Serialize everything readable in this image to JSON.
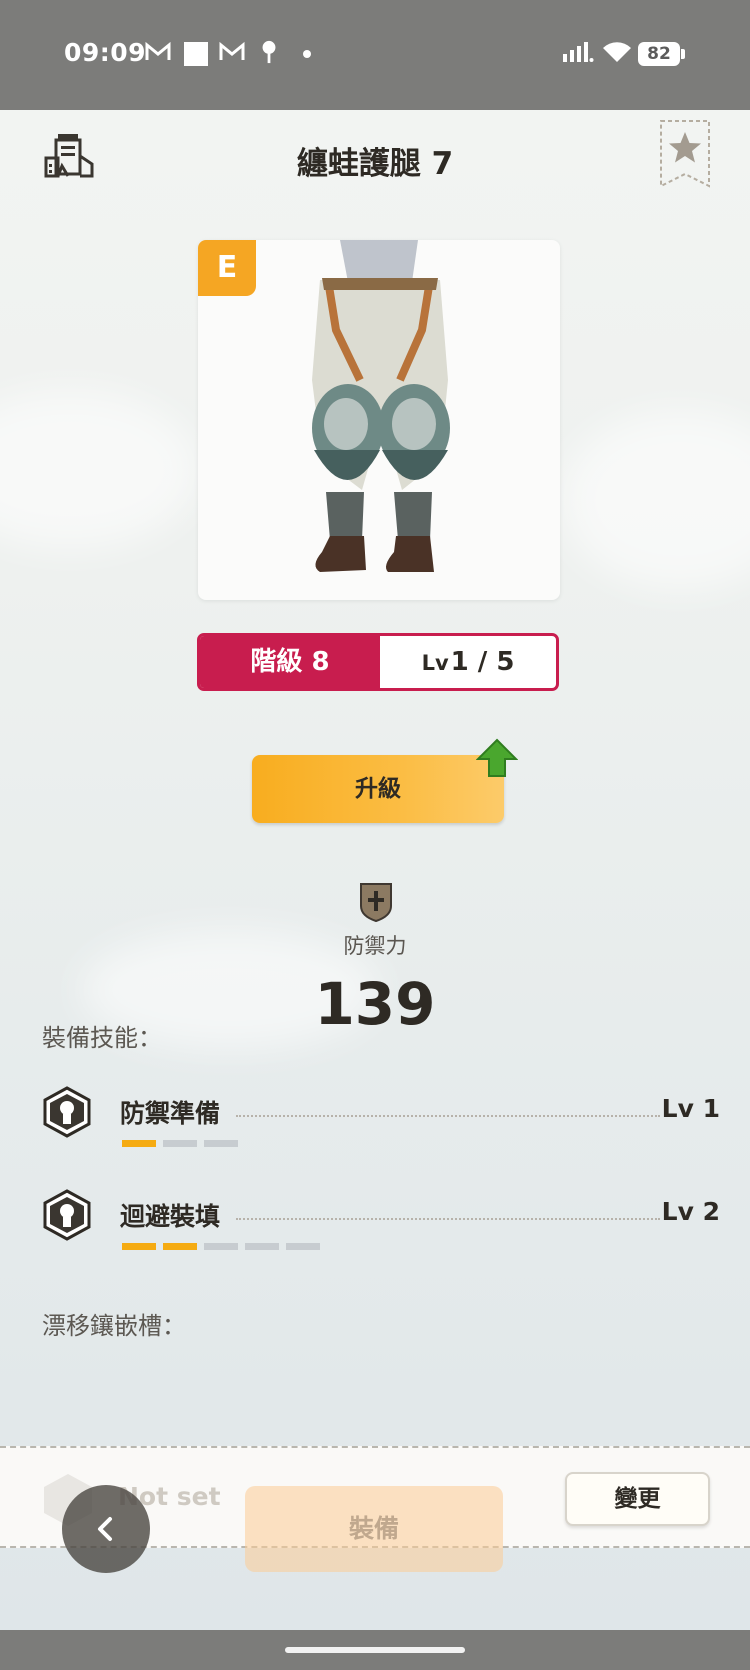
{
  "status_bar": {
    "time": "09:09",
    "icons": [
      "gmail-icon",
      "square-icon",
      "gmail-icon",
      "pin-icon",
      "dot-icon",
      "signal-icon",
      "wifi-icon"
    ],
    "battery": "82"
  },
  "header": {
    "title": "纏蛙護腿 7",
    "left_icon": "building-icon",
    "right_icon": "star-icon"
  },
  "equipment": {
    "rarity": "E",
    "rarity_color": "#f5a623",
    "image": "equipment-legs-image"
  },
  "rank": {
    "rank_label": "階級 8",
    "level_prefix": "Lv",
    "level": "1 / 5",
    "accent_color": "#c81d4e"
  },
  "upgrade": {
    "label": "升級",
    "indicator_icon": "up-arrow-icon"
  },
  "stats": {
    "defense_label": "防禦力",
    "defense_value": "139",
    "icon": "shield-icon"
  },
  "skills": {
    "label": "裝備技能：",
    "items": [
      {
        "name": "防禦準備",
        "level": "Lv 1",
        "current": 1,
        "max": 3
      },
      {
        "name": "迴避裝填",
        "level": "Lv 2",
        "current": 2,
        "max": 5
      }
    ]
  },
  "slots": {
    "label": "漂移鑲嵌槽：",
    "value": "Not set",
    "change_label": "變更"
  },
  "footer": {
    "equip_label": "裝備",
    "back_icon": "chevron-left-icon"
  }
}
